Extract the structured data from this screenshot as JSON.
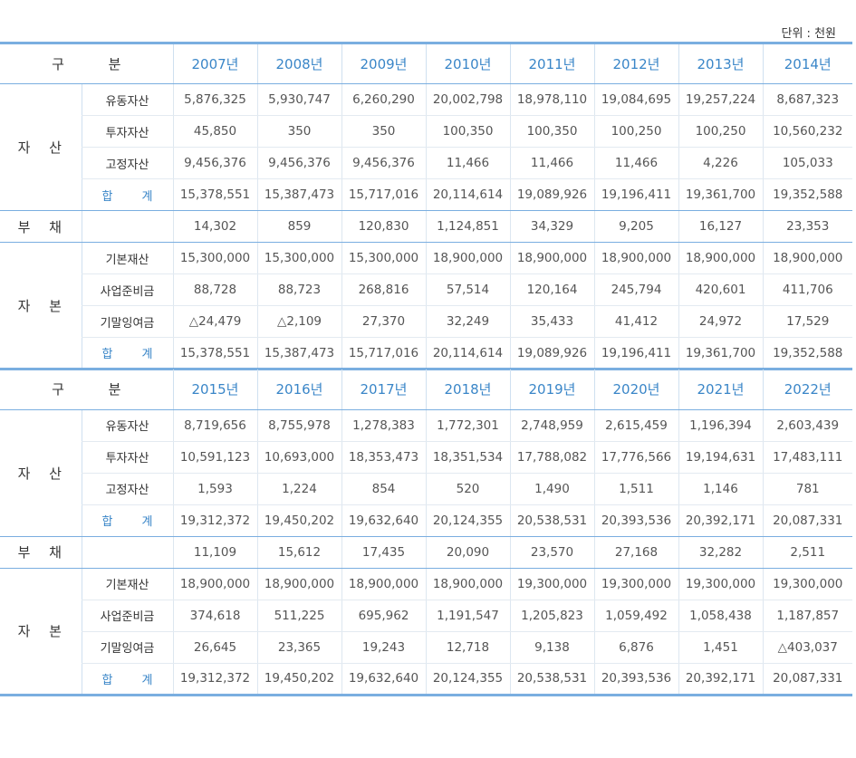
{
  "unit_label": "단위 : 천원",
  "header_label": "구 분",
  "groups": {
    "assets": "자 산",
    "liabilities": "부 채",
    "capital": "자 본"
  },
  "rows": {
    "current_assets": "유동자산",
    "investment_assets": "투자자산",
    "fixed_assets": "고정자산",
    "total": "합 계",
    "basic_property": "기본재산",
    "reserve_fund": "사업준비금",
    "retained_surplus": "기말잉여금"
  },
  "tables": [
    {
      "years": [
        "2007년",
        "2008년",
        "2009년",
        "2010년",
        "2011년",
        "2012년",
        "2013년",
        "2014년"
      ],
      "current_assets": [
        "5,876,325",
        "5,930,747",
        "6,260,290",
        "20,002,798",
        "18,978,110",
        "19,084,695",
        "19,257,224",
        "8,687,323"
      ],
      "investment_assets": [
        "45,850",
        "350",
        "350",
        "100,350",
        "100,350",
        "100,250",
        "100,250",
        "10,560,232"
      ],
      "fixed_assets": [
        "9,456,376",
        "9,456,376",
        "9,456,376",
        "11,466",
        "11,466",
        "11,466",
        "4,226",
        "105,033"
      ],
      "assets_total": [
        "15,378,551",
        "15,387,473",
        "15,717,016",
        "20,114,614",
        "19,089,926",
        "19,196,411",
        "19,361,700",
        "19,352,588"
      ],
      "liabilities": [
        "14,302",
        "859",
        "120,830",
        "1,124,851",
        "34,329",
        "9,205",
        "16,127",
        "23,353"
      ],
      "basic_property": [
        "15,300,000",
        "15,300,000",
        "15,300,000",
        "18,900,000",
        "18,900,000",
        "18,900,000",
        "18,900,000",
        "18,900,000"
      ],
      "reserve_fund": [
        "88,728",
        "88,723",
        "268,816",
        "57,514",
        "120,164",
        "245,794",
        "420,601",
        "411,706"
      ],
      "retained_surplus": [
        "△24,479",
        "△2,109",
        "27,370",
        "32,249",
        "35,433",
        "41,412",
        "24,972",
        "17,529"
      ],
      "capital_total": [
        "15,378,551",
        "15,387,473",
        "15,717,016",
        "20,114,614",
        "19,089,926",
        "19,196,411",
        "19,361,700",
        "19,352,588"
      ]
    },
    {
      "years": [
        "2015년",
        "2016년",
        "2017년",
        "2018년",
        "2019년",
        "2020년",
        "2021년",
        "2022년"
      ],
      "current_assets": [
        "8,719,656",
        "8,755,978",
        "1,278,383",
        "1,772,301",
        "2,748,959",
        "2,615,459",
        "1,196,394",
        "2,603,439"
      ],
      "investment_assets": [
        "10,591,123",
        "10,693,000",
        "18,353,473",
        "18,351,534",
        "17,788,082",
        "17,776,566",
        "19,194,631",
        "17,483,111"
      ],
      "fixed_assets": [
        "1,593",
        "1,224",
        "854",
        "520",
        "1,490",
        "1,511",
        "1,146",
        "781"
      ],
      "assets_total": [
        "19,312,372",
        "19,450,202",
        "19,632,640",
        "20,124,355",
        "20,538,531",
        "20,393,536",
        "20,392,171",
        "20,087,331"
      ],
      "liabilities": [
        "11,109",
        "15,612",
        "17,435",
        "20,090",
        "23,570",
        "27,168",
        "32,282",
        "2,511"
      ],
      "basic_property": [
        "18,900,000",
        "18,900,000",
        "18,900,000",
        "18,900,000",
        "19,300,000",
        "19,300,000",
        "19,300,000",
        "19,300,000"
      ],
      "reserve_fund": [
        "374,618",
        "511,225",
        "695,962",
        "1,191,547",
        "1,205,823",
        "1,059,492",
        "1,058,438",
        "1,187,857"
      ],
      "retained_surplus": [
        "26,645",
        "23,365",
        "19,243",
        "12,718",
        "9,138",
        "6,876",
        "1,451",
        "△403,037"
      ],
      "capital_total": [
        "19,312,372",
        "19,450,202",
        "19,632,640",
        "20,124,355",
        "20,538,531",
        "20,393,536",
        "20,392,171",
        "20,087,331"
      ]
    }
  ]
}
